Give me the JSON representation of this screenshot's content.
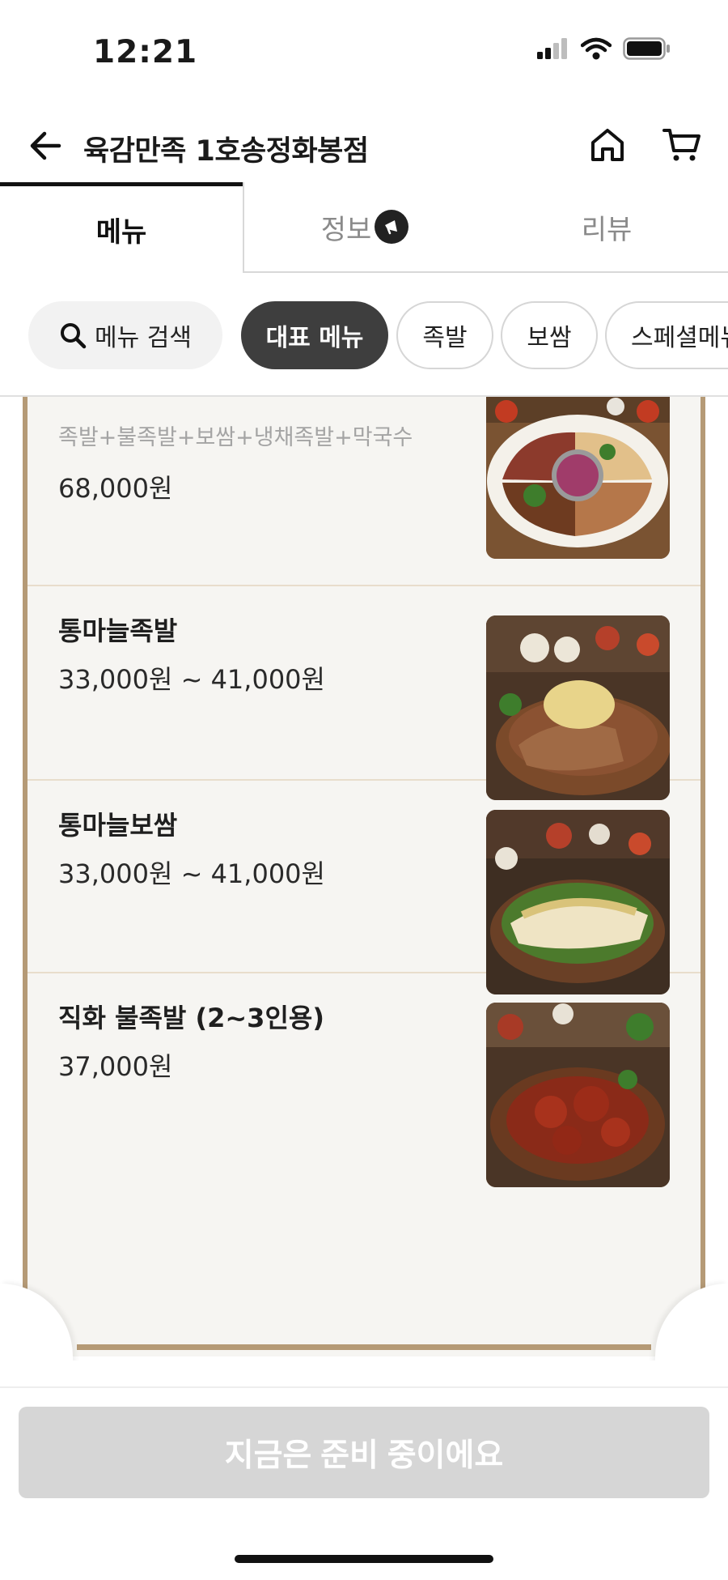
{
  "status_bar": {
    "time": "12:21",
    "icons": [
      "signal-icon",
      "wifi-icon",
      "battery-icon"
    ]
  },
  "header": {
    "title": "육감만족 1호송정화봉점",
    "icons": [
      "back-arrow-icon",
      "home-icon",
      "cart-icon"
    ]
  },
  "tabs": [
    {
      "label": "메뉴",
      "selected": true
    },
    {
      "label": "정보",
      "selected": false,
      "badge_icon": "megaphone-icon"
    },
    {
      "label": "리뷰",
      "selected": false
    }
  ],
  "chips": {
    "search_label": "메뉴 검색",
    "items": [
      {
        "label": "대표 메뉴",
        "selected": true
      },
      {
        "label": "족발",
        "selected": false
      },
      {
        "label": "보쌈",
        "selected": false
      },
      {
        "label": "스페셜메뉴",
        "selected": false
      }
    ]
  },
  "menu_items": [
    {
      "name": "",
      "description": "족발+불족발+보쌈+냉채족발+막국수",
      "price": "68,000원",
      "photo_icon": "platter-photo"
    },
    {
      "name": "통마늘족발",
      "price": "33,000원 ~ 41,000원",
      "photo_icon": "garlic-jokbal-photo"
    },
    {
      "name": "통마늘보쌈",
      "price": "33,000원 ~ 41,000원",
      "photo_icon": "garlic-bossam-photo"
    },
    {
      "name": "직화 불족발 (2~3인용)",
      "price": "37,000원",
      "photo_icon": "spicy-jokbal-photo"
    }
  ],
  "order_button": {
    "label": "지금은 준비 중이에요",
    "enabled": false
  },
  "colors": {
    "board_border": "#b59a76",
    "chip_selected": "#3e3e3e",
    "button_disabled": "#d6d6d6"
  }
}
